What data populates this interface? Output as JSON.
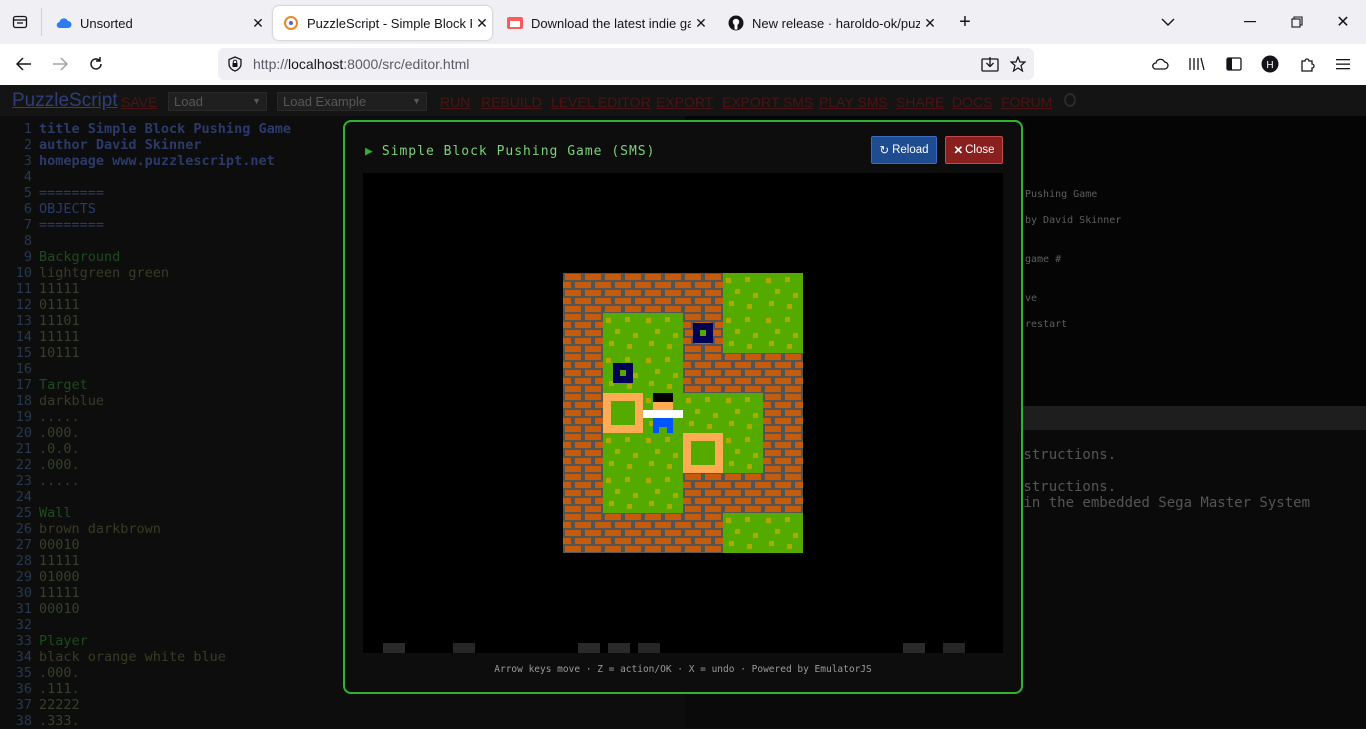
{
  "browser": {
    "tabs": [
      {
        "title": "Unsorted",
        "icon": "cloud-icon",
        "active": false
      },
      {
        "title": "PuzzleScript - Simple Block Pushing Game",
        "icon": "puzzlescript-icon",
        "active": true
      },
      {
        "title": "Download the latest indie games",
        "icon": "itchio-icon",
        "active": false
      },
      {
        "title": "New release · haroldo-ok/puzzlescript",
        "icon": "github-icon",
        "active": false
      }
    ],
    "url_prefix": "http://",
    "url_host": "localhost",
    "url_path": ":8000/src/editor.html"
  },
  "editor": {
    "brand": "PuzzleScript",
    "menu": [
      "SAVE",
      "RUN",
      "REBUILD",
      "LEVEL EDITOR",
      "EXPORT",
      "EXPORT SMS",
      "PLAY SMS",
      "SHARE",
      "DOCS",
      "FORUM"
    ],
    "load_select": "Load",
    "load_example_select": "Load Example",
    "code_lines": [
      "title Simple Block Pushing Game",
      "author David Skinner",
      "homepage www.puzzlescript.net",
      "",
      "========",
      "OBJECTS",
      "========",
      "",
      "Background",
      "lightgreen green",
      "11111",
      "01111",
      "11101",
      "11111",
      "10111",
      "",
      "Target",
      "darkblue",
      ".....",
      ".000.",
      ".0.0.",
      ".000.",
      ".....",
      "",
      "Wall",
      "brown darkbrown",
      "00010",
      "11111",
      "01000",
      "11111",
      "00010",
      "",
      "Player",
      "black orange white blue",
      ".000.",
      ".111.",
      "22222",
      ".333."
    ],
    "game_preview_lines": [
      "Pushing Game",
      "by David Skinner",
      "game #",
      "ve",
      "restart"
    ],
    "console_lines": [
      "nstructions.",
      "nstructions.",
      " in the embedded Sega Master System"
    ]
  },
  "modal": {
    "title": "Simple Block Pushing Game (SMS)",
    "reload_label": "Reload",
    "close_label": "Close",
    "footer": "Arrow keys move · Z = action/OK · X = undo · Powered by EmulatorJS",
    "level_map": [
      "WWWWGG",
      "WGGWGG",
      "WGGWWW",
      "WOPGGW",
      "WGGTGW",
      "WGGWWW",
      "WWWWGG"
    ],
    "crate_cells": [
      [
        1,
        2
      ],
      [
        3,
        1
      ]
    ],
    "colors": {
      "brick": "#c55b0c",
      "mortar": "#555555",
      "grass": "#55aa00",
      "grass_dot": "#aaaa00",
      "crate": "#000055",
      "target": "#ffaa55",
      "player_hair": "#000000",
      "player_skin": "#ffaa55",
      "player_shirt": "#ffffff",
      "player_pants": "#0055ff"
    }
  }
}
